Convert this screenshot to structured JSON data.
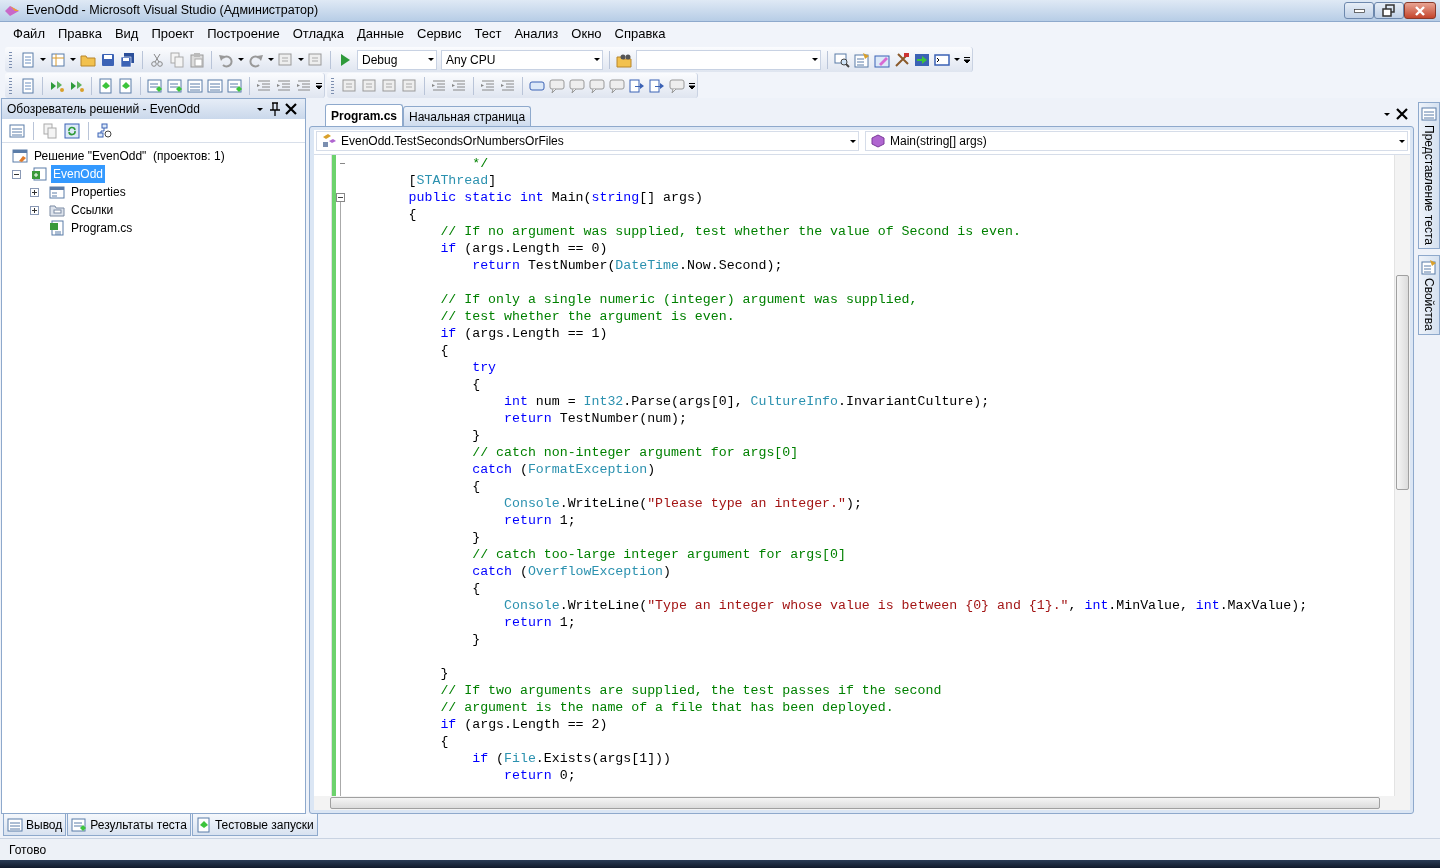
{
  "window": {
    "title": "EvenOdd - Microsoft Visual Studio (Администратор)"
  },
  "menu": [
    "Файл",
    "Правка",
    "Вид",
    "Проект",
    "Построение",
    "Отладка",
    "Данные",
    "Сервис",
    "Тест",
    "Анализ",
    "Окно",
    "Справка"
  ],
  "toolbar": {
    "configuration": "Debug",
    "platform": "Any CPU"
  },
  "solution_explorer": {
    "title": "Обозреватель решений - EvenOdd",
    "tree": [
      {
        "label": "Решение \"EvenOdd\"  (проектов: 1)",
        "kind": "solution",
        "selected": false,
        "children": [
          {
            "label": "EvenOdd",
            "kind": "project",
            "selected": true,
            "expanded": true,
            "children": [
              {
                "label": "Properties",
                "kind": "properties",
                "selected": false,
                "expanded": false
              },
              {
                "label": "Ссылки",
                "kind": "references",
                "selected": false,
                "expanded": false
              },
              {
                "label": "Program.cs",
                "kind": "file",
                "selected": false
              }
            ]
          }
        ]
      }
    ]
  },
  "editor": {
    "tabs": [
      {
        "label": "Program.cs",
        "selected": true
      },
      {
        "label": "Начальная страница",
        "selected": false
      }
    ],
    "type_combo": "EvenOdd.TestSecondsOrNumbersOrFiles",
    "member_combo": "Main(string[] args)",
    "lines": [
      {
        "kind": "code",
        "region_end": true,
        "segments": [
          {
            "kind": "comment",
            "text": "                */"
          }
        ]
      },
      {
        "kind": "code",
        "segments": [
          {
            "kind": "plain",
            "text": "        ["
          },
          {
            "kind": "type",
            "text": "STAThread"
          },
          {
            "kind": "plain",
            "text": "]"
          }
        ]
      },
      {
        "kind": "code",
        "collapsible": true,
        "segments": [
          {
            "kind": "keyword",
            "text": "        public static int"
          },
          {
            "kind": "plain",
            "text": " Main("
          },
          {
            "kind": "keyword",
            "text": "string"
          },
          {
            "kind": "plain",
            "text": "[] args)"
          }
        ]
      },
      {
        "kind": "code",
        "segments": [
          {
            "kind": "plain",
            "text": "        {"
          }
        ]
      },
      {
        "kind": "code",
        "segments": [
          {
            "kind": "comment",
            "text": "            // If no argument was supplied, test whether the value of Second is even."
          }
        ]
      },
      {
        "kind": "code",
        "segments": [
          {
            "kind": "keyword",
            "text": "            if"
          },
          {
            "kind": "plain",
            "text": " (args.Length == 0)"
          }
        ]
      },
      {
        "kind": "code",
        "segments": [
          {
            "kind": "keyword",
            "text": "                return"
          },
          {
            "kind": "plain",
            "text": " TestNumber("
          },
          {
            "kind": "type",
            "text": "DateTime"
          },
          {
            "kind": "plain",
            "text": ".Now.Second);"
          }
        ]
      },
      {
        "kind": "blank"
      },
      {
        "kind": "code",
        "segments": [
          {
            "kind": "comment",
            "text": "            // If only a single numeric (integer) argument was supplied,"
          }
        ]
      },
      {
        "kind": "code",
        "segments": [
          {
            "kind": "comment",
            "text": "            // test whether the argument is even."
          }
        ]
      },
      {
        "kind": "code",
        "segments": [
          {
            "kind": "keyword",
            "text": "            if"
          },
          {
            "kind": "plain",
            "text": " (args.Length == 1)"
          }
        ]
      },
      {
        "kind": "code",
        "segments": [
          {
            "kind": "plain",
            "text": "            {"
          }
        ]
      },
      {
        "kind": "code",
        "segments": [
          {
            "kind": "keyword",
            "text": "                try"
          }
        ]
      },
      {
        "kind": "code",
        "segments": [
          {
            "kind": "plain",
            "text": "                {"
          }
        ]
      },
      {
        "kind": "code",
        "segments": [
          {
            "kind": "keyword",
            "text": "                    int"
          },
          {
            "kind": "plain",
            "text": " num = "
          },
          {
            "kind": "type",
            "text": "Int32"
          },
          {
            "kind": "plain",
            "text": ".Parse(args[0], "
          },
          {
            "kind": "type",
            "text": "CultureInfo"
          },
          {
            "kind": "plain",
            "text": ".InvariantCulture);"
          }
        ]
      },
      {
        "kind": "code",
        "segments": [
          {
            "kind": "keyword",
            "text": "                    return"
          },
          {
            "kind": "plain",
            "text": " TestNumber(num);"
          }
        ]
      },
      {
        "kind": "code",
        "segments": [
          {
            "kind": "plain",
            "text": "                }"
          }
        ]
      },
      {
        "kind": "code",
        "segments": [
          {
            "kind": "comment",
            "text": "                // catch non-integer argument for args[0]"
          }
        ]
      },
      {
        "kind": "code",
        "segments": [
          {
            "kind": "keyword",
            "text": "                catch"
          },
          {
            "kind": "plain",
            "text": " ("
          },
          {
            "kind": "type",
            "text": "FormatException"
          },
          {
            "kind": "plain",
            "text": ")"
          }
        ]
      },
      {
        "kind": "code",
        "segments": [
          {
            "kind": "plain",
            "text": "                {"
          }
        ]
      },
      {
        "kind": "code",
        "segments": [
          {
            "kind": "type",
            "text": "                    Console"
          },
          {
            "kind": "plain",
            "text": ".WriteLine("
          },
          {
            "kind": "string",
            "text": "\"Please type an integer.\""
          },
          {
            "kind": "plain",
            "text": ");"
          }
        ]
      },
      {
        "kind": "code",
        "segments": [
          {
            "kind": "keyword",
            "text": "                    return"
          },
          {
            "kind": "plain",
            "text": " 1;"
          }
        ]
      },
      {
        "kind": "code",
        "segments": [
          {
            "kind": "plain",
            "text": "                }"
          }
        ]
      },
      {
        "kind": "code",
        "segments": [
          {
            "kind": "comment",
            "text": "                // catch too-large integer argument for args[0]"
          }
        ]
      },
      {
        "kind": "code",
        "segments": [
          {
            "kind": "keyword",
            "text": "                catch"
          },
          {
            "kind": "plain",
            "text": " ("
          },
          {
            "kind": "type",
            "text": "OverflowException"
          },
          {
            "kind": "plain",
            "text": ")"
          }
        ]
      },
      {
        "kind": "code",
        "segments": [
          {
            "kind": "plain",
            "text": "                {"
          }
        ]
      },
      {
        "kind": "code",
        "segments": [
          {
            "kind": "type",
            "text": "                    Console"
          },
          {
            "kind": "plain",
            "text": ".WriteLine("
          },
          {
            "kind": "string",
            "text": "\"Type an integer whose value is between {0} and {1}.\""
          },
          {
            "kind": "plain",
            "text": ", "
          },
          {
            "kind": "keyword",
            "text": "int"
          },
          {
            "kind": "plain",
            "text": ".MinValue, "
          },
          {
            "kind": "keyword",
            "text": "int"
          },
          {
            "kind": "plain",
            "text": ".MaxValue);"
          }
        ]
      },
      {
        "kind": "code",
        "segments": [
          {
            "kind": "keyword",
            "text": "                    return"
          },
          {
            "kind": "plain",
            "text": " 1;"
          }
        ]
      },
      {
        "kind": "code",
        "segments": [
          {
            "kind": "plain",
            "text": "                }"
          }
        ]
      },
      {
        "kind": "blank"
      },
      {
        "kind": "code",
        "segments": [
          {
            "kind": "plain",
            "text": "            }"
          }
        ]
      },
      {
        "kind": "code",
        "segments": [
          {
            "kind": "comment",
            "text": "            // If two arguments are supplied, the test passes if the second"
          }
        ]
      },
      {
        "kind": "code",
        "segments": [
          {
            "kind": "comment",
            "text": "            // argument is the name of a file that has been deployed."
          }
        ]
      },
      {
        "kind": "code",
        "segments": [
          {
            "kind": "keyword",
            "text": "            if"
          },
          {
            "kind": "plain",
            "text": " (args.Length == 2)"
          }
        ]
      },
      {
        "kind": "code",
        "segments": [
          {
            "kind": "plain",
            "text": "            {"
          }
        ]
      },
      {
        "kind": "code",
        "segments": [
          {
            "kind": "keyword",
            "text": "                if"
          },
          {
            "kind": "plain",
            "text": " ("
          },
          {
            "kind": "type",
            "text": "File"
          },
          {
            "kind": "plain",
            "text": ".Exists(args[1]))"
          }
        ]
      },
      {
        "kind": "code",
        "segments": [
          {
            "kind": "keyword",
            "text": "                    return"
          },
          {
            "kind": "plain",
            "text": " 0;"
          }
        ]
      }
    ]
  },
  "side_tabs": [
    "Представление теста",
    "Свойства"
  ],
  "bottom_tabs": [
    "Вывод",
    "Результаты теста",
    "Тестовые запуски"
  ],
  "status_bar": "Готово"
}
